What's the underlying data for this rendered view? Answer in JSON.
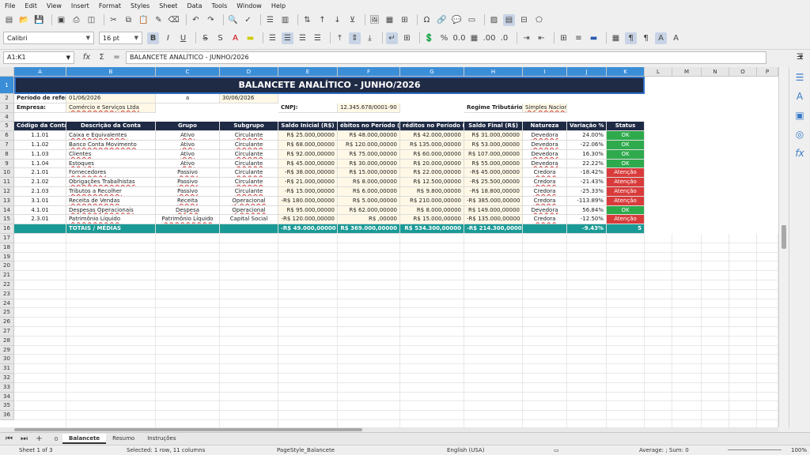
{
  "menu": [
    "File",
    "Edit",
    "View",
    "Insert",
    "Format",
    "Styles",
    "Sheet",
    "Data",
    "Tools",
    "Window",
    "Help"
  ],
  "toolbar": {
    "font_name": "Calibri",
    "font_size": "16 pt"
  },
  "formula_bar": {
    "cell_ref": "A1:K1",
    "formula": "BALANCETE ANALÍTICO - JUNHO/2026"
  },
  "columns": [
    "A",
    "B",
    "C",
    "D",
    "E",
    "F",
    "G",
    "H",
    "I",
    "J",
    "K",
    "L",
    "M",
    "N",
    "O",
    "P"
  ],
  "rows": [
    "1",
    "2",
    "3",
    "4",
    "5",
    "6",
    "7",
    "8",
    "9",
    "10",
    "11",
    "12",
    "13",
    "14",
    "15",
    "16",
    "17",
    "18",
    "19",
    "20",
    "21",
    "22",
    "23",
    "24",
    "25",
    "26",
    "27",
    "28",
    "29",
    "30",
    "31",
    "32",
    "33",
    "34",
    "35",
    "36"
  ],
  "sheet": {
    "title": "BALANCETE ANALÍTICO - JUNHO/2026",
    "period_label": "Período de referê",
    "period_start": "01/06/2026",
    "period_to": "a",
    "period_end": "30/06/2026",
    "company_label": "Empresa:",
    "company": "Comércio e Serviços Ltda",
    "cnpj_label": "CNPJ:",
    "cnpj": "12.345.678/0001-90",
    "regime_label": "Regime Tributário:",
    "regime": "Simples Nacional",
    "headers": [
      "Código da Conta",
      "Descrição da Conta",
      "Grupo",
      "Subgrupo",
      "Saldo Inicial (R$)",
      "ébitos no Período (R$",
      "réditos no Período (R$",
      "Saldo Final (R$)",
      "Natureza",
      "Variação %",
      "Status"
    ],
    "rows": [
      [
        "1.1.01",
        "Caixa e Equivalentes",
        "Ativo",
        "Circulante",
        "R$ 25.000,00000",
        "R$ 48.000,00000",
        "R$ 42.000,00000",
        "R$ 31.000,00000",
        "Devedora",
        "24.00%",
        "OK"
      ],
      [
        "1.1.02",
        "Banco Conta Movimento",
        "Ativo",
        "Circulante",
        "R$ 68.000,00000",
        "R$ 120.000,00000",
        "R$ 135.000,00000",
        "R$ 53.000,00000",
        "Devedora",
        "-22.06%",
        "OK"
      ],
      [
        "1.1.03",
        "Clientes",
        "Ativo",
        "Circulante",
        "R$ 92.000,00000",
        "R$ 75.000,00000",
        "R$ 60.000,00000",
        "R$ 107.000,00000",
        "Devedora",
        "16.30%",
        "OK"
      ],
      [
        "1.1.04",
        "Estoques",
        "Ativo",
        "Circulante",
        "R$ 45.000,00000",
        "R$ 30.000,00000",
        "R$ 20.000,00000",
        "R$ 55.000,00000",
        "Devedora",
        "22.22%",
        "OK"
      ],
      [
        "2.1.01",
        "Fornecedores",
        "Passivo",
        "Circulante",
        "-R$ 38.000,00000",
        "R$ 15.000,00000",
        "R$ 22.000,00000",
        "-R$ 45.000,00000",
        "Credora",
        "-18.42%",
        "Atenção"
      ],
      [
        "2.1.02",
        "Obrigações Trabalhistas",
        "Passivo",
        "Circulante",
        "-R$ 21.000,00000",
        "R$ 8.000,00000",
        "R$ 12.500,00000",
        "-R$ 25.500,00000",
        "Credora",
        "-21.43%",
        "Atenção"
      ],
      [
        "2.1.03",
        "Tributos a Recolher",
        "Passivo",
        "Circulante",
        "-R$ 15.000,00000",
        "R$ 6.000,00000",
        "R$ 9.800,00000",
        "-R$ 18.800,00000",
        "Credora",
        "-25.33%",
        "Atenção"
      ],
      [
        "3.1.01",
        "Receita de Vendas",
        "Receita",
        "Operacional",
        "-R$ 180.000,00000",
        "R$ 5.000,00000",
        "R$ 210.000,00000",
        "-R$ 385.000,00000",
        "Credora",
        "-113.89%",
        "Atenção"
      ],
      [
        "4.1.01",
        "Despesas Operacionais",
        "Despesa",
        "Operacional",
        "R$ 95.000,00000",
        "R$ 62.000,00000",
        "R$ 8.000,00000",
        "R$ 149.000,00000",
        "Devedora",
        "56.84%",
        "OK"
      ],
      [
        "2.3.01",
        "Patrimônio Líquido",
        "Patrimônio Líquido",
        "Capital Social",
        "-R$ 120.000,00000",
        "R$ ,00000",
        "R$ 15.000,00000",
        "-R$ 135.000,00000",
        "Credora",
        "-12.50%",
        "Atenção"
      ]
    ],
    "totals": [
      "",
      "TOTAIS / MÉDIAS",
      "",
      "",
      "-R$ 49.000,00000",
      "R$ 369.000,00000",
      "R$ 534.300,00000",
      "-R$ 214.300,00000",
      "",
      "-9.43%",
      "5"
    ]
  },
  "tabs": [
    "Balancete",
    "Resumo",
    "Instruções"
  ],
  "tab_counter": "0",
  "status": {
    "sheet": "Sheet 1 of 3",
    "selection": "Selected: 1 row, 11 columns",
    "page_style": "PageStyle_Balancete",
    "language": "English (USA)",
    "summary": "Average: ; Sum: 0",
    "zoom": "100%"
  },
  "colors": {
    "header_bg": "#1f2a44",
    "ok": "#2eaa4c",
    "warn": "#d93b3b",
    "total": "#1a9a96",
    "selection": "#3a8ed8"
  }
}
